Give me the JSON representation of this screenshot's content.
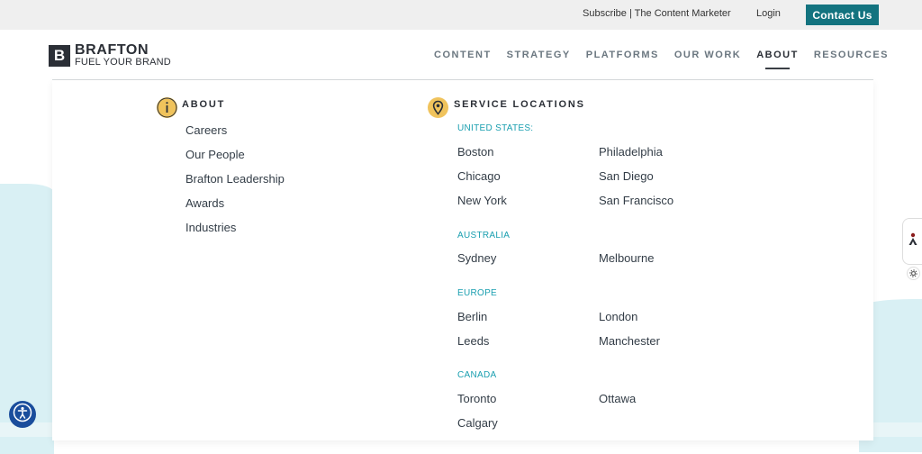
{
  "topbar": {
    "subscribe": "Subscribe | The Content Marketer",
    "login": "Login",
    "contact": "Contact Us"
  },
  "logo": {
    "name": "BRAFTON",
    "tagline": "FUEL YOUR BRAND",
    "mark": "B"
  },
  "nav": [
    "CONTENT",
    "STRATEGY",
    "PLATFORMS",
    "OUR WORK",
    "ABOUT",
    "RESOURCES"
  ],
  "nav_active": "ABOUT",
  "about": {
    "title": "ABOUT",
    "icon": "info-icon",
    "links": [
      "Careers",
      "Our People",
      "Brafton Leadership",
      "Awards",
      "Industries"
    ]
  },
  "locations": {
    "title": "SERVICE LOCATIONS",
    "icon": "map-pin-icon",
    "regions": [
      {
        "name": "UNITED STATES:",
        "cities": [
          "Boston",
          "Philadelphia",
          "Chicago",
          "San Diego",
          "New York",
          "San Francisco"
        ]
      },
      {
        "name": "AUSTRALIA",
        "cities": [
          "Sydney",
          "Melbourne"
        ]
      },
      {
        "name": "EUROPE",
        "cities": [
          "Berlin",
          "London",
          "Leeds",
          "Manchester"
        ]
      },
      {
        "name": "CANADA",
        "cities": [
          "Toronto",
          "Ottawa",
          "Calgary"
        ]
      }
    ]
  },
  "colors": {
    "accent": "#13737f",
    "region": "#1a9fb0",
    "icon_bg": "#f0c35c"
  }
}
